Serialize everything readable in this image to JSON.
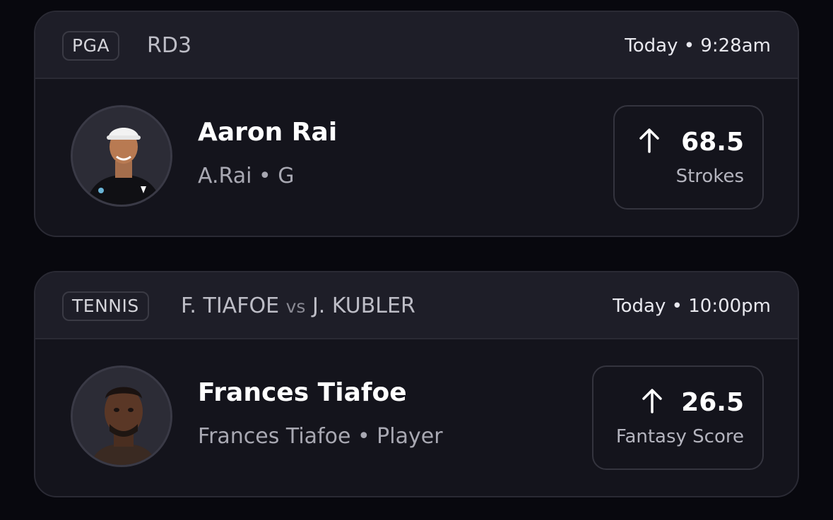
{
  "cards": [
    {
      "league": "PGA",
      "event": "RD3",
      "time": "Today • 9:28am",
      "player": {
        "name": "Aaron Rai",
        "sub": "A.Rai • G",
        "avatar": "player-photo-golfer"
      },
      "projection": {
        "value": "68.5",
        "stat": "Strokes",
        "direction_icon": "arrow-up-icon"
      }
    },
    {
      "league": "TENNIS",
      "event": {
        "team1": "F. TIAFOE",
        "vs": "vs",
        "team2": "J. KUBLER"
      },
      "time": "Today • 10:00pm",
      "player": {
        "name": "Frances Tiafoe",
        "sub": "Frances Tiafoe • Player",
        "avatar": "player-photo-tennis"
      },
      "projection": {
        "value": "26.5",
        "stat": "Fantasy Score",
        "direction_icon": "arrow-up-icon"
      }
    }
  ]
}
